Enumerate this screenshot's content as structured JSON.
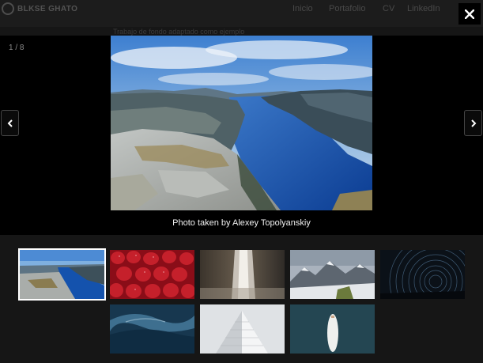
{
  "site": {
    "logo_text": "BLKSE GHATO",
    "nav": [
      "Inicio",
      "Portafolio",
      "CV",
      "LinkedIn"
    ],
    "subtitle": "Trabajo de fondo adaptado como ejemplo"
  },
  "lightbox": {
    "counter": "1 / 8",
    "caption": "Photo taken by Alexey Topolyanskiy",
    "close_icon": "close-icon",
    "prev_icon": "chevron-left-icon",
    "next_icon": "chevron-right-icon"
  },
  "thumbnails": [
    {
      "name": "fjord",
      "active": true
    },
    {
      "name": "strawberries",
      "active": false
    },
    {
      "name": "waterfall",
      "active": false
    },
    {
      "name": "snowy-mountains",
      "active": false
    },
    {
      "name": "star-trails",
      "active": false
    },
    {
      "name": "ocean-wave",
      "active": false
    },
    {
      "name": "white-pyramid",
      "active": false
    },
    {
      "name": "surfboard",
      "active": false
    }
  ],
  "colors": {
    "stage": "#000000",
    "page": "#161616",
    "accent": "#ffffff"
  }
}
